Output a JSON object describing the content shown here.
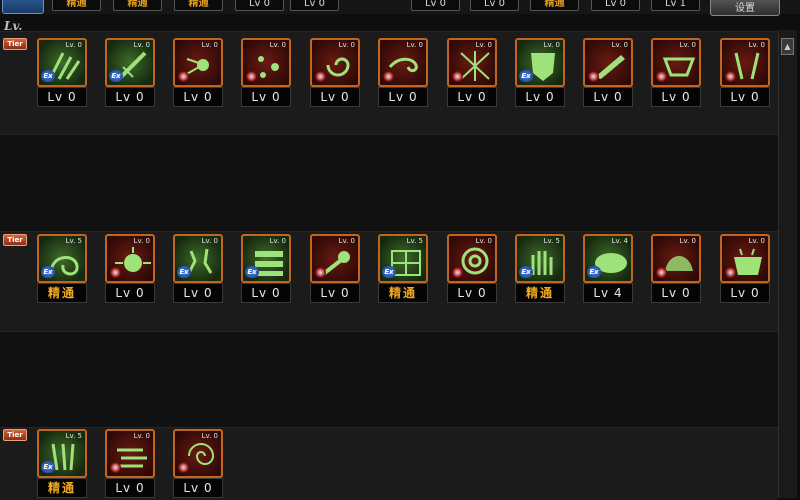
{
  "top_bar": {
    "slots": [
      {
        "label": "精通",
        "kind": "mastery"
      },
      {
        "label": "精通",
        "kind": "mastery"
      },
      {
        "label": "精通",
        "kind": "mastery"
      },
      {
        "label": "Lv 0",
        "kind": "level"
      },
      {
        "label": "Lv 0",
        "kind": "level"
      },
      {
        "label": "Lv 0",
        "kind": "level"
      },
      {
        "label": "Lv 0",
        "kind": "level"
      },
      {
        "label": "精通",
        "kind": "mastery"
      },
      {
        "label": "Lv 0",
        "kind": "level"
      },
      {
        "label": "Lv 1",
        "kind": "level"
      }
    ],
    "button_label": "设置"
  },
  "header_label": "Lv.",
  "tier_label": "Tier",
  "colors": {
    "mastery_text": "#f0a820",
    "frame_border": "#c2651f",
    "icon_glyph": "#9ee27a",
    "background": "#0e0e0e"
  },
  "rows": [
    {
      "skills": [
        {
          "icon": "claw-strike-icon",
          "frame": "green",
          "badge": "ex",
          "icon_level": "Lv. 0",
          "level": "Lv 0"
        },
        {
          "icon": "slash-icon",
          "frame": "green",
          "badge": "ex",
          "icon_level": "Lv. 0",
          "level": "Lv 0"
        },
        {
          "icon": "burst-icon",
          "frame": "red",
          "badge": "lock",
          "icon_level": "Lv. 0",
          "level": "Lv 0"
        },
        {
          "icon": "scatter-icon",
          "frame": "red",
          "badge": "lock",
          "icon_level": "Lv. 0",
          "level": "Lv 0"
        },
        {
          "icon": "spiral-icon",
          "frame": "red",
          "badge": "lock",
          "icon_level": "Lv. 0",
          "level": "Lv 0"
        },
        {
          "icon": "hook-icon",
          "frame": "red",
          "badge": "lock",
          "icon_level": "Lv. 0",
          "level": "Lv 0"
        },
        {
          "icon": "cross-mesh-icon",
          "frame": "red",
          "badge": "lock",
          "icon_level": "Lv. 0",
          "level": "Lv 0"
        },
        {
          "icon": "mask-icon",
          "frame": "green",
          "badge": "ex",
          "icon_level": "Lv. 0",
          "level": "Lv 0"
        },
        {
          "icon": "blade-dash-icon",
          "frame": "red",
          "badge": "lock",
          "icon_level": "Lv. 0",
          "level": "Lv 0"
        },
        {
          "icon": "jaw-icon",
          "frame": "red",
          "badge": "lock",
          "icon_level": "Lv. 0",
          "level": "Lv 0"
        },
        {
          "icon": "twin-fang-icon",
          "frame": "red",
          "badge": "lock",
          "icon_level": "Lv. 0",
          "level": "Lv 0"
        }
      ]
    },
    {
      "skills": [
        {
          "icon": "coiled-beast-icon",
          "frame": "green",
          "badge": "ex",
          "icon_level": "Lv. 5",
          "level": "精通"
        },
        {
          "icon": "fist-burst-icon",
          "frame": "red",
          "badge": "lock",
          "icon_level": "Lv. 0",
          "level": "Lv 0"
        },
        {
          "icon": "sparks-icon",
          "frame": "green",
          "badge": "ex",
          "icon_level": "Lv. 0",
          "level": "Lv 0"
        },
        {
          "icon": "stack-icon",
          "frame": "green",
          "badge": "ex",
          "icon_level": "Lv. 0",
          "level": "Lv 0"
        },
        {
          "icon": "comet-icon",
          "frame": "red",
          "badge": "lock",
          "icon_level": "Lv. 0",
          "level": "Lv 0"
        },
        {
          "icon": "net-icon",
          "frame": "green",
          "badge": "ex",
          "icon_level": "Lv. 5",
          "level": "精通"
        },
        {
          "icon": "swirl-icon",
          "frame": "red",
          "badge": "lock",
          "icon_level": "Lv. 0",
          "level": "Lv 0"
        },
        {
          "icon": "grasp-icon",
          "frame": "green",
          "badge": "ex",
          "icon_level": "Lv. 5",
          "level": "精通"
        },
        {
          "icon": "cloud-icon",
          "frame": "green",
          "badge": "ex",
          "icon_level": "Lv. 4",
          "level": "Lv 4"
        },
        {
          "icon": "shadow-icon",
          "frame": "red",
          "badge": "lock",
          "icon_level": "Lv. 0",
          "level": "Lv 0"
        },
        {
          "icon": "cauldron-icon",
          "frame": "red",
          "badge": "lock",
          "icon_level": "Lv. 0",
          "level": "Lv 0"
        }
      ]
    },
    {
      "skills": [
        {
          "icon": "talon-icon",
          "frame": "green",
          "badge": "ex",
          "icon_level": "Lv. 5",
          "level": "精通"
        },
        {
          "icon": "rush-icon",
          "frame": "red",
          "badge": "lock",
          "icon_level": "Lv. 0",
          "level": "Lv 0"
        },
        {
          "icon": "vortex-icon",
          "frame": "red",
          "badge": "lock",
          "icon_level": "Lv. 0",
          "level": "Lv 0"
        }
      ]
    }
  ]
}
